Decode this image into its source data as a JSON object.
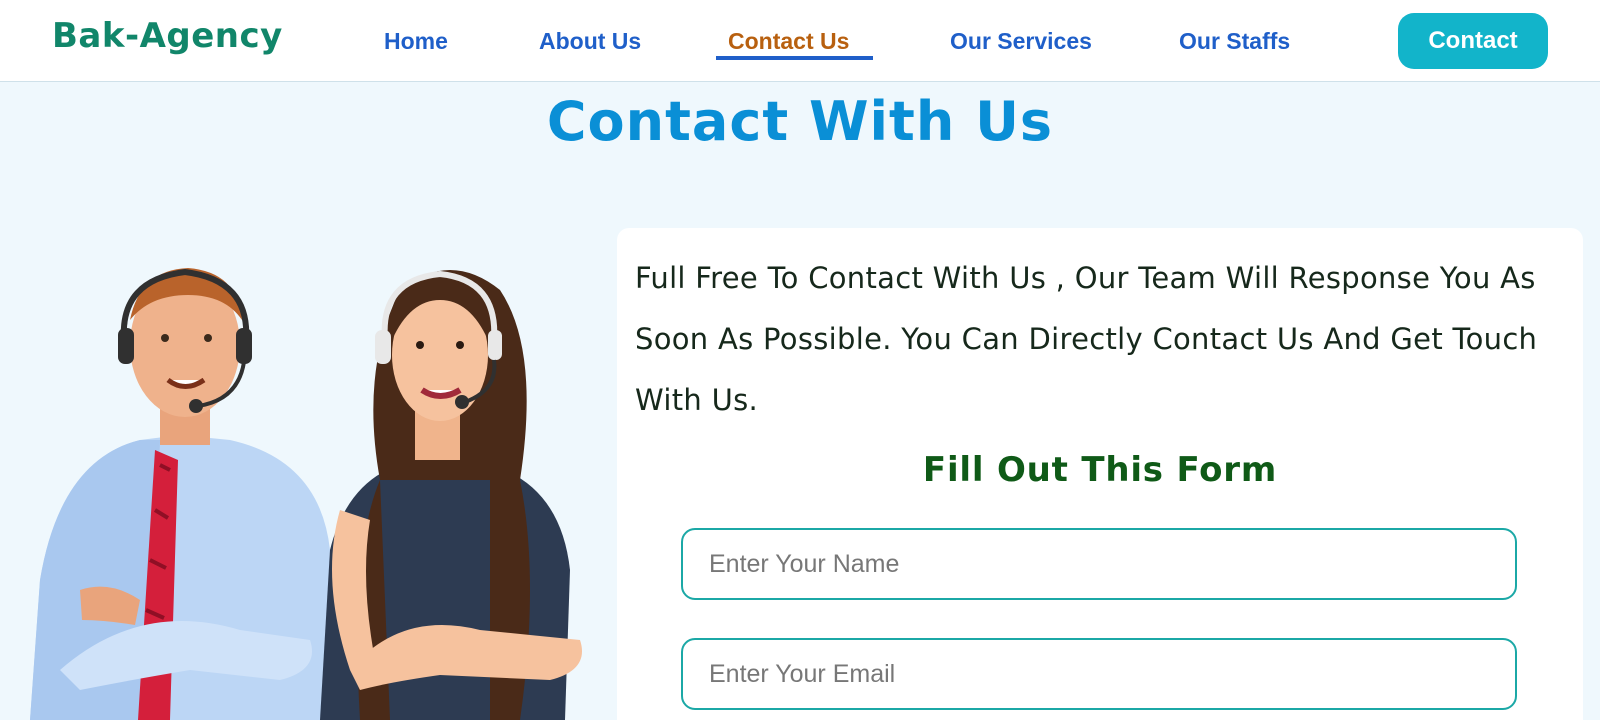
{
  "header": {
    "logo": "Bak-Agency",
    "nav": [
      {
        "label": "Home",
        "active": false
      },
      {
        "label": "About Us",
        "active": false
      },
      {
        "label": "Contact Us",
        "active": true
      },
      {
        "label": "Our Services",
        "active": false
      },
      {
        "label": "Our Staffs",
        "active": false
      }
    ],
    "cta_label": "Contact"
  },
  "main": {
    "title": "Contact With Us",
    "intro": "Full Free To Contact With Us , Our Team Will Response You As Soon As Possible. You Can Directly Contact Us And Get Touch With Us.",
    "form": {
      "heading": "Fill Out This Form",
      "name_placeholder": "Enter Your Name",
      "email_placeholder": "Enter Your Email"
    }
  },
  "colors": {
    "logo": "#11866a",
    "nav_link": "#1f5fc9",
    "nav_active": "#b8600f",
    "button": "#12b4ca",
    "title": "#0a8fd6",
    "form_heading": "#0f5a17",
    "field_border": "#1ba8a6",
    "page_bg": "#eff8fd"
  },
  "illustration": {
    "subject": "two-support-agents-with-headsets"
  }
}
